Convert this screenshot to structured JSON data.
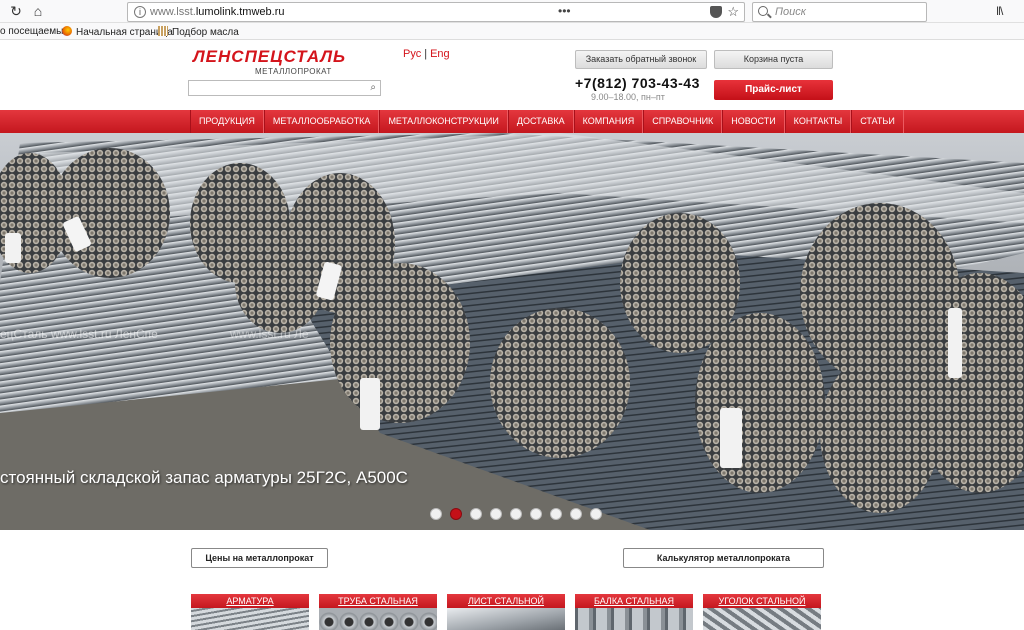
{
  "browser": {
    "url_prefix": "www.lsst.",
    "url_domain": "lumolink.tmweb.ru",
    "search_placeholder": "Поиск",
    "bookmarks": [
      "о посещаемые",
      "Начальная страница",
      "Подбор масла"
    ]
  },
  "header": {
    "logo": "ЛЕНСПЕЦСТАЛЬ",
    "logo_sub": "МЕТАЛЛОПРОКАТ",
    "lang_ru": "Рус",
    "lang_en": "Eng",
    "callback_label": "Заказать обратный звонок",
    "phone": "+7(812) 703-43-43",
    "hours": "9.00–18.00, пн–пт",
    "cart_label": "Корзина пуста",
    "pricelist_label": "Прайс-лист"
  },
  "nav": {
    "items": [
      "ПРОДУКЦИЯ",
      "МЕТАЛЛООБРАБОТКА",
      "МЕТАЛЛОКОНСТРУКЦИИ",
      "ДОСТАВКА",
      "КОМПАНИЯ",
      "СПРАВОЧНИК",
      "НОВОСТИ",
      "КОНТАКТЫ",
      "СТАТЬИ"
    ]
  },
  "hero": {
    "caption": "стоянный складской запас арматуры 25Г2С, А500С",
    "watermark": "ецСталь   www.lsst.ru   ЛенСпе",
    "watermark2": "www.lsst.ru   Ле",
    "slides_total": 9,
    "active_slide": 2
  },
  "actions": {
    "prices_label": "Цены на металлопрокат",
    "calc_label": "Калькулятор металлопроката"
  },
  "tiles": [
    "АРМАТУРА",
    "ТРУБА СТАЛЬНАЯ",
    "ЛИСТ СТАЛЬНОЙ",
    "БАЛКА СТАЛЬНАЯ",
    "УГОЛОК СТАЛЬНОЙ"
  ],
  "colors": {
    "brand_red": "#d4141b",
    "nav_red": "#c4171e"
  }
}
